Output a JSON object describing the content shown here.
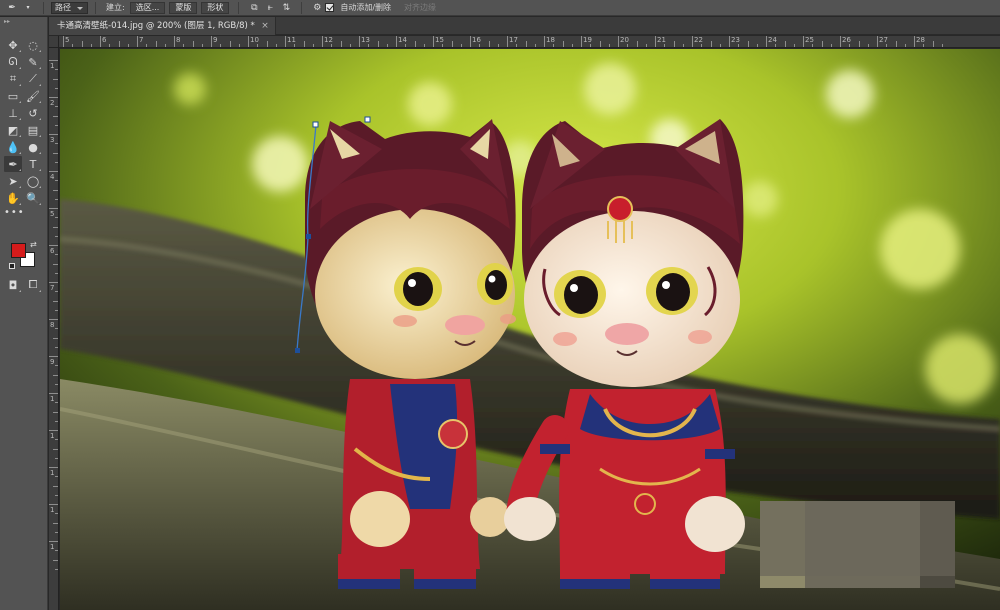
{
  "options_bar": {
    "tool_mode": "路径",
    "make_label": "建立:",
    "selection_btn": "选区...",
    "mask_btn": "蒙版",
    "shape_btn": "形状",
    "auto_add_delete": "自动添加/删除",
    "align_edges": "对齐边缘"
  },
  "document": {
    "tab_title": "卡通高清壁纸-014.jpg @ 200% (图层 1, RGB/8) *",
    "close_glyph": "×"
  },
  "rulers": {
    "top": [
      "5",
      "6",
      "7",
      "8",
      "9",
      "10",
      "11",
      "12",
      "13",
      "14",
      "15",
      "16",
      "17",
      "18",
      "19",
      "20",
      "21",
      "22",
      "23",
      "24",
      "25",
      "26",
      "27",
      "28"
    ],
    "left": [
      "1",
      "2",
      "3",
      "4",
      "5",
      "6",
      "7",
      "8",
      "9",
      "1",
      "1",
      "1",
      "1",
      "1"
    ]
  },
  "colors": {
    "foreground": "#d51b1b",
    "background": "#ffffff",
    "panel": "#535353"
  },
  "tools": [
    {
      "name": "move-tool-icon",
      "glyph": "✥"
    },
    {
      "name": "marquee-tool-icon",
      "glyph": "◌"
    },
    {
      "name": "lasso-tool-icon",
      "glyph": "ᘏ"
    },
    {
      "name": "quick-select-tool-icon",
      "glyph": "✎"
    },
    {
      "name": "crop-tool-icon",
      "glyph": "⌗"
    },
    {
      "name": "eyedropper-tool-icon",
      "glyph": "⟋"
    },
    {
      "name": "healing-brush-tool-icon",
      "glyph": "▭"
    },
    {
      "name": "brush-tool-icon",
      "glyph": "🖌"
    },
    {
      "name": "clone-stamp-tool-icon",
      "glyph": "⊥"
    },
    {
      "name": "history-brush-tool-icon",
      "glyph": "↺"
    },
    {
      "name": "eraser-tool-icon",
      "glyph": "◩"
    },
    {
      "name": "gradient-tool-icon",
      "glyph": "▤"
    },
    {
      "name": "blur-tool-icon",
      "glyph": "💧"
    },
    {
      "name": "dodge-tool-icon",
      "glyph": "●"
    },
    {
      "name": "pen-tool-icon",
      "glyph": "✒"
    },
    {
      "name": "type-tool-icon",
      "glyph": "T"
    },
    {
      "name": "path-select-tool-icon",
      "glyph": "➤"
    },
    {
      "name": "shape-tool-icon",
      "glyph": "◯"
    },
    {
      "name": "hand-tool-icon",
      "glyph": "✋"
    },
    {
      "name": "zoom-tool-icon",
      "glyph": "🔍"
    }
  ]
}
